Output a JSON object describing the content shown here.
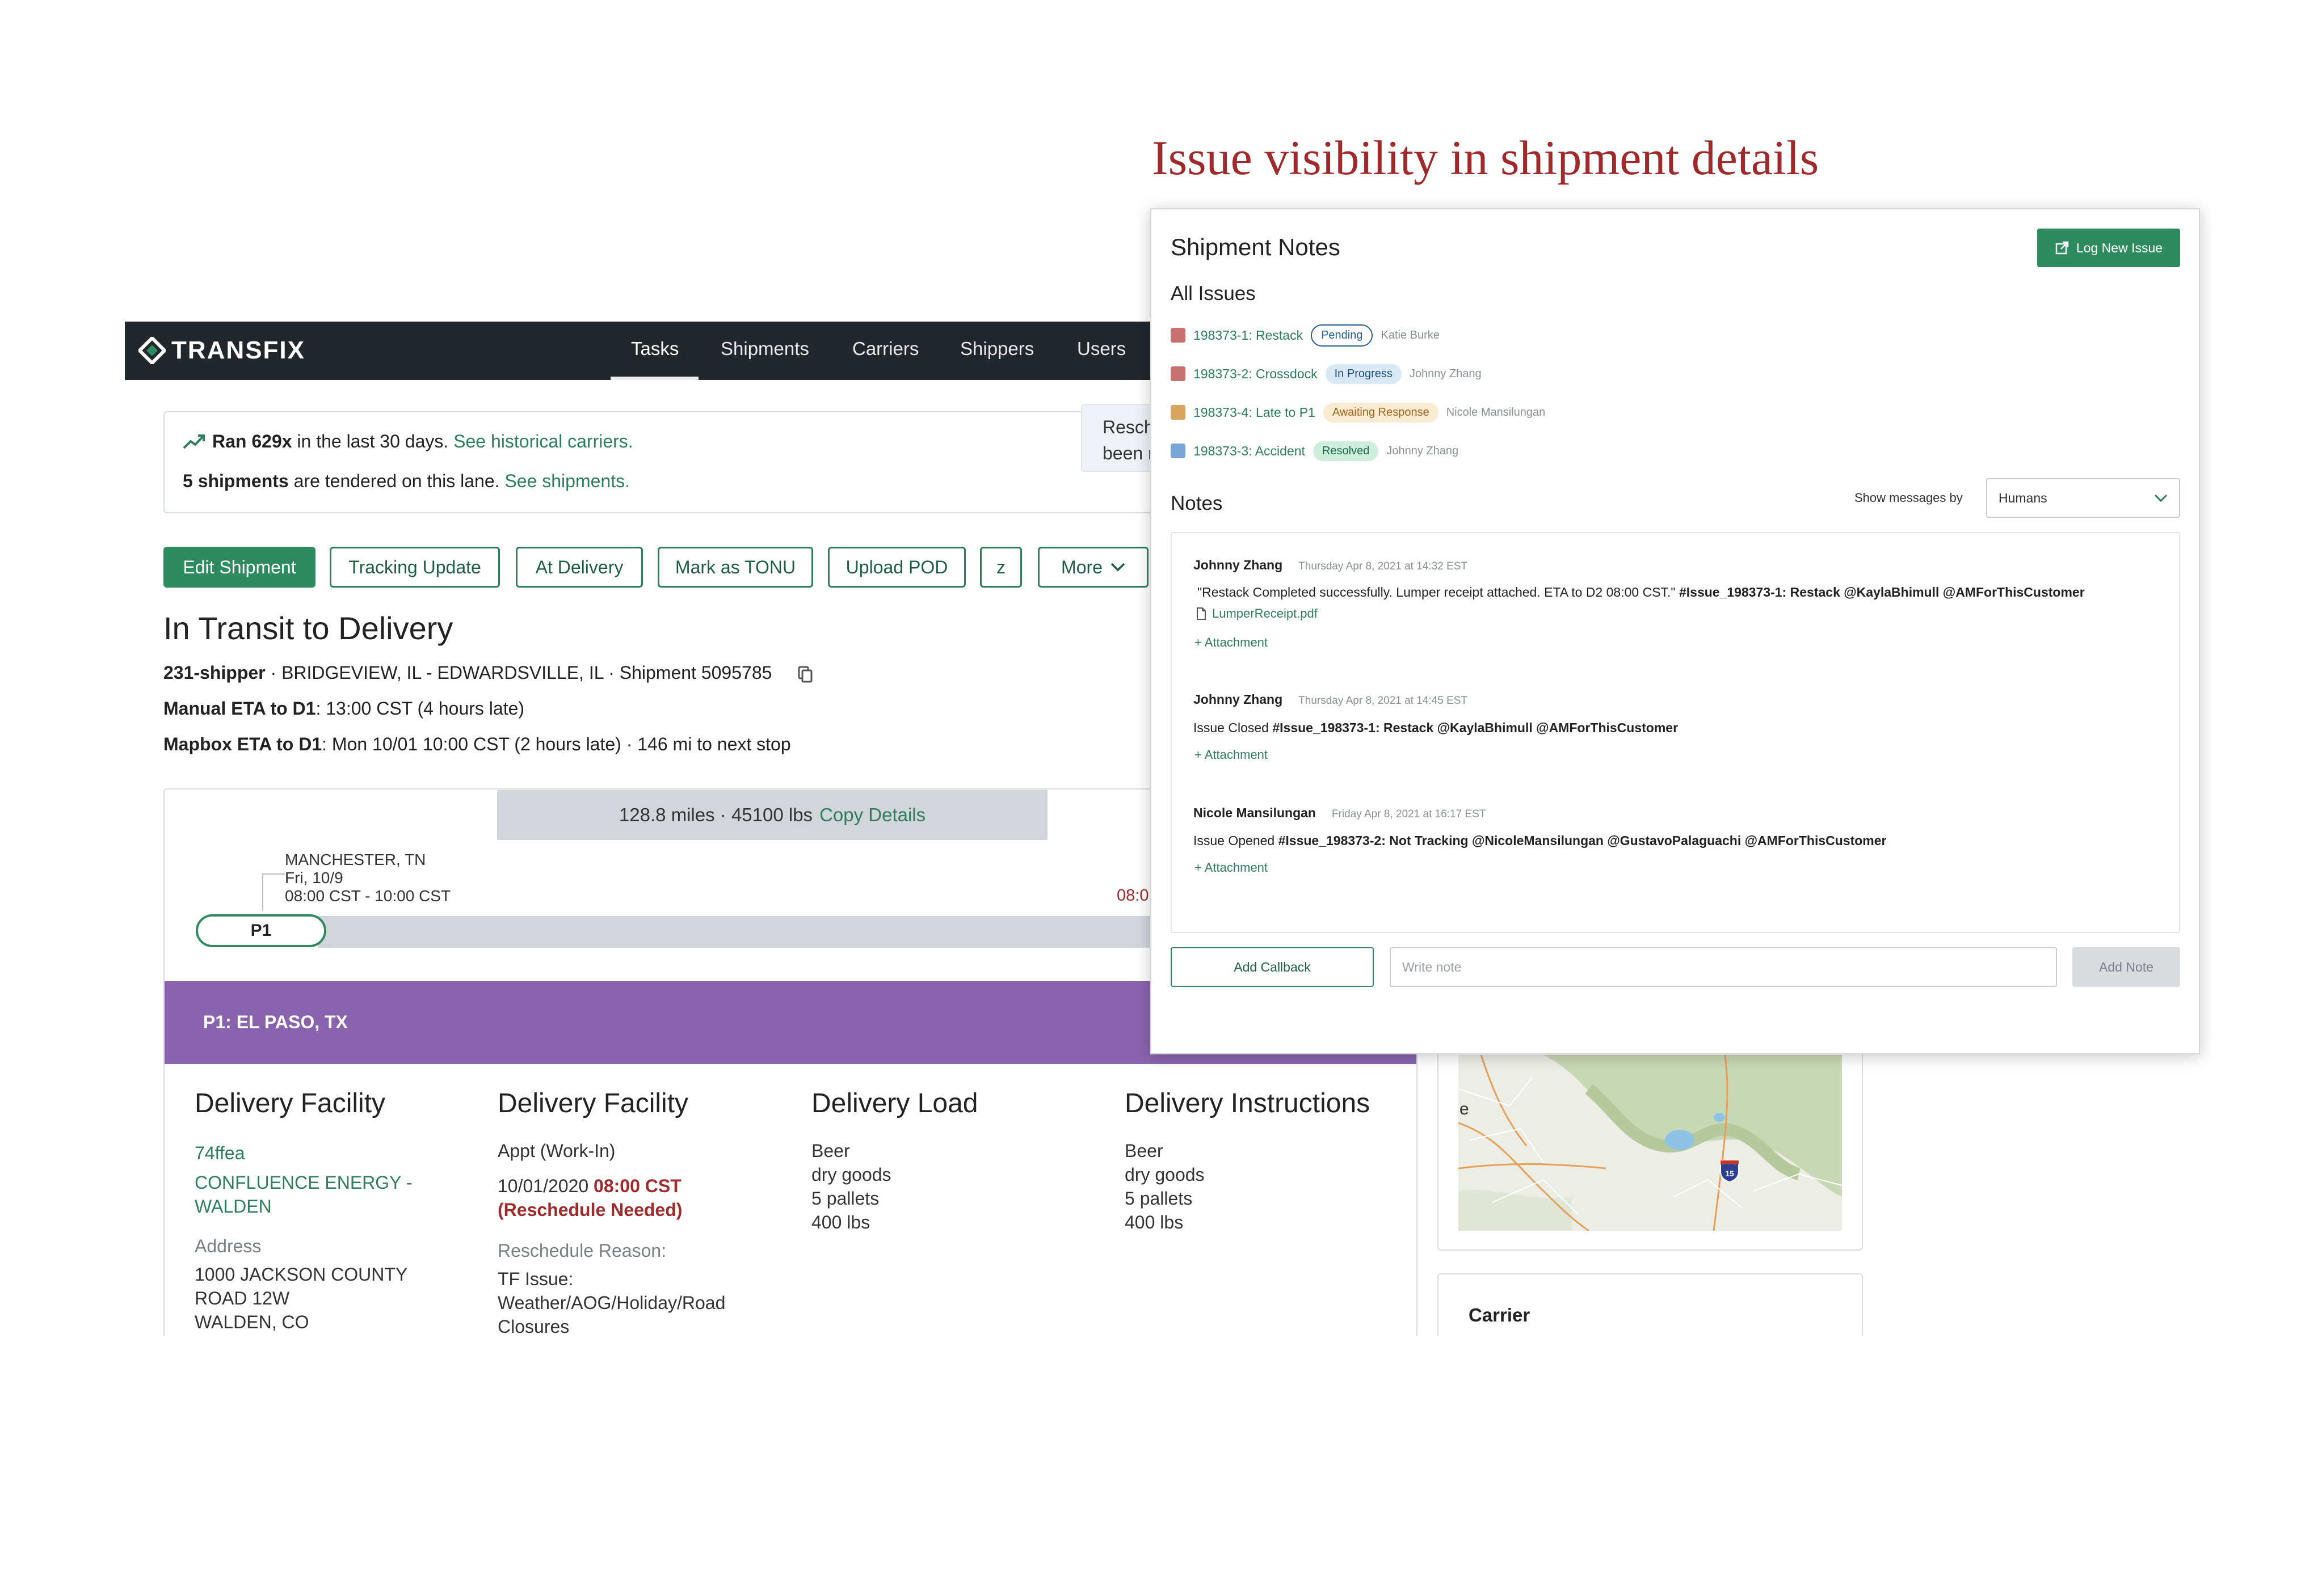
{
  "heading": "Issue visibility in shipment details",
  "nav": {
    "logo": "TRANSFIX",
    "items": [
      "Tasks",
      "Shipments",
      "Carriers",
      "Shippers",
      "Users"
    ],
    "active": "Tasks"
  },
  "lane": {
    "ran_bold": "Ran 629x",
    "ran_rest": "in the last 30 days.",
    "ran_link": "See historical carriers.",
    "tendered_bold": "5 shipments",
    "tendered_rest": "are tendered on this lane.",
    "tendered_link": "See shipments."
  },
  "reschedule_note": {
    "line1": "Resch",
    "line2": "been r"
  },
  "actions": {
    "edit": "Edit Shipment",
    "tracking": "Tracking Update",
    "at_delivery": "At Delivery",
    "tonu": "Mark as TONU",
    "pod": "Upload POD",
    "z": "z",
    "more": "More"
  },
  "shipment": {
    "status": "In Transit to Delivery",
    "shipper": "231-shipper",
    "lane_desc": "· BRIDGEVIEW, IL - EDWARDSVILLE, IL · Shipment 5095785",
    "manual_eta_label": "Manual ETA to D1",
    "manual_eta_value": ":  13:00 CST (4 hours late)",
    "mapbox_eta_label": "Mapbox ETA to D1",
    "mapbox_eta_value": ": Mon 10/01 10:00 CST (2 hours late) · 146 mi to next stop"
  },
  "route": {
    "summary": "128.8 miles · 45100 lbs",
    "copy_link": "Copy Details",
    "stop_city": "MANCHESTER, TN",
    "stop_date": "Fri, 10/9",
    "stop_window": "08:00 CST - 10:00 CST",
    "pill": "P1",
    "red_eta": "08:0"
  },
  "stop_header": "P1: EL PASO, TX",
  "facility": {
    "heading": "Delivery Facility",
    "code": "74ffea",
    "name_line1": "CONFLUENCE ENERGY -",
    "name_line2": "WALDEN",
    "address_label": "Address",
    "address_line1": "1000 JACKSON COUNTY",
    "address_line2": "ROAD 12W",
    "address_line3": "WALDEN, CO"
  },
  "facility2": {
    "heading": "Delivery Facility",
    "appt": "Appt (Work-In)",
    "date": "10/01/2020",
    "time": "08:00 CST",
    "reschedule": "(Reschedule Needed)",
    "reason_label": "Reschedule Reason:",
    "reason_line1": "TF Issue:",
    "reason_line2": "Weather/AOG/Holiday/Road",
    "reason_line3": "Closures"
  },
  "load": {
    "heading": "Delivery Load",
    "lines": [
      "Beer",
      "dry goods",
      "5 pallets",
      "400 lbs"
    ]
  },
  "instructions": {
    "heading": "Delivery Instructions",
    "lines": [
      "Beer",
      "dry goods",
      "5 pallets",
      "400 lbs"
    ]
  },
  "map": {
    "edge_letter": "e",
    "shield": "15"
  },
  "carrier_label": "Carrier",
  "panel": {
    "title": "Shipment Notes",
    "log_button": "Log New Issue",
    "all_issues": "All Issues",
    "issues": [
      {
        "name": "198373-1: Restack",
        "status": "Pending",
        "assignee": "Katie Burke",
        "color": "#c97070",
        "badge_bg": "#ffffff",
        "badge_fg": "#2a5d8f",
        "badge_border": "#2a5d8f"
      },
      {
        "name": "198373-2: Crossdock",
        "status": "In Progress",
        "assignee": "Johnny Zhang",
        "color": "#c97070",
        "badge_bg": "#d8e8f6",
        "badge_fg": "#1f4f7a",
        "badge_border": "#d8e8f6"
      },
      {
        "name": "198373-4: Late to P1",
        "status": "Awaiting Response",
        "assignee": "Nicole Mansilungan",
        "color": "#d7a560",
        "badge_bg": "#fbebd2",
        "badge_fg": "#a0641a",
        "badge_border": "#fbebd2"
      },
      {
        "name": "198373-3: Accident",
        "status": "Resolved",
        "assignee": "Johnny Zhang",
        "color": "#7aa6d6",
        "badge_bg": "#cdeedd",
        "badge_fg": "#1f6b45",
        "badge_border": "#cdeedd"
      }
    ],
    "notes_label": "Notes",
    "show_by_label": "Show messages by",
    "show_by_value": "Humans",
    "notes": [
      {
        "author": "Johnny Zhang",
        "time": "Thursday Apr 8, 2021 at 14:32 EST",
        "body_plain": "\"Restack Completed successfully.  Lumper receipt attached.  ETA to D2 08:00 CST.\"",
        "body_bold": "#Issue_198373-1: Restack @KaylaBhimull  @AMForThisCustomer",
        "file": "LumperReceipt.pdf",
        "attach": "+ Attachment"
      },
      {
        "author": "Johnny Zhang",
        "time": "Thursday Apr 8, 2021 at 14:45 EST",
        "body_plain": "Issue Closed",
        "body_bold": "#Issue_198373-1: Restack @KaylaBhimull  @AMForThisCustomer",
        "attach": "+ Attachment"
      },
      {
        "author": "Nicole Mansilungan",
        "time": "Friday Apr 8, 2021 at 16:17 EST",
        "body_plain": "Issue Opened",
        "body_bold": "#Issue_198373-2: Not Tracking @NicoleMansilungan @GustavoPalaguachi  @AMForThisCustomer",
        "attach": "+ Attachment"
      }
    ],
    "add_callback": "Add Callback",
    "write_placeholder": "Write note",
    "add_note": "Add Note"
  }
}
